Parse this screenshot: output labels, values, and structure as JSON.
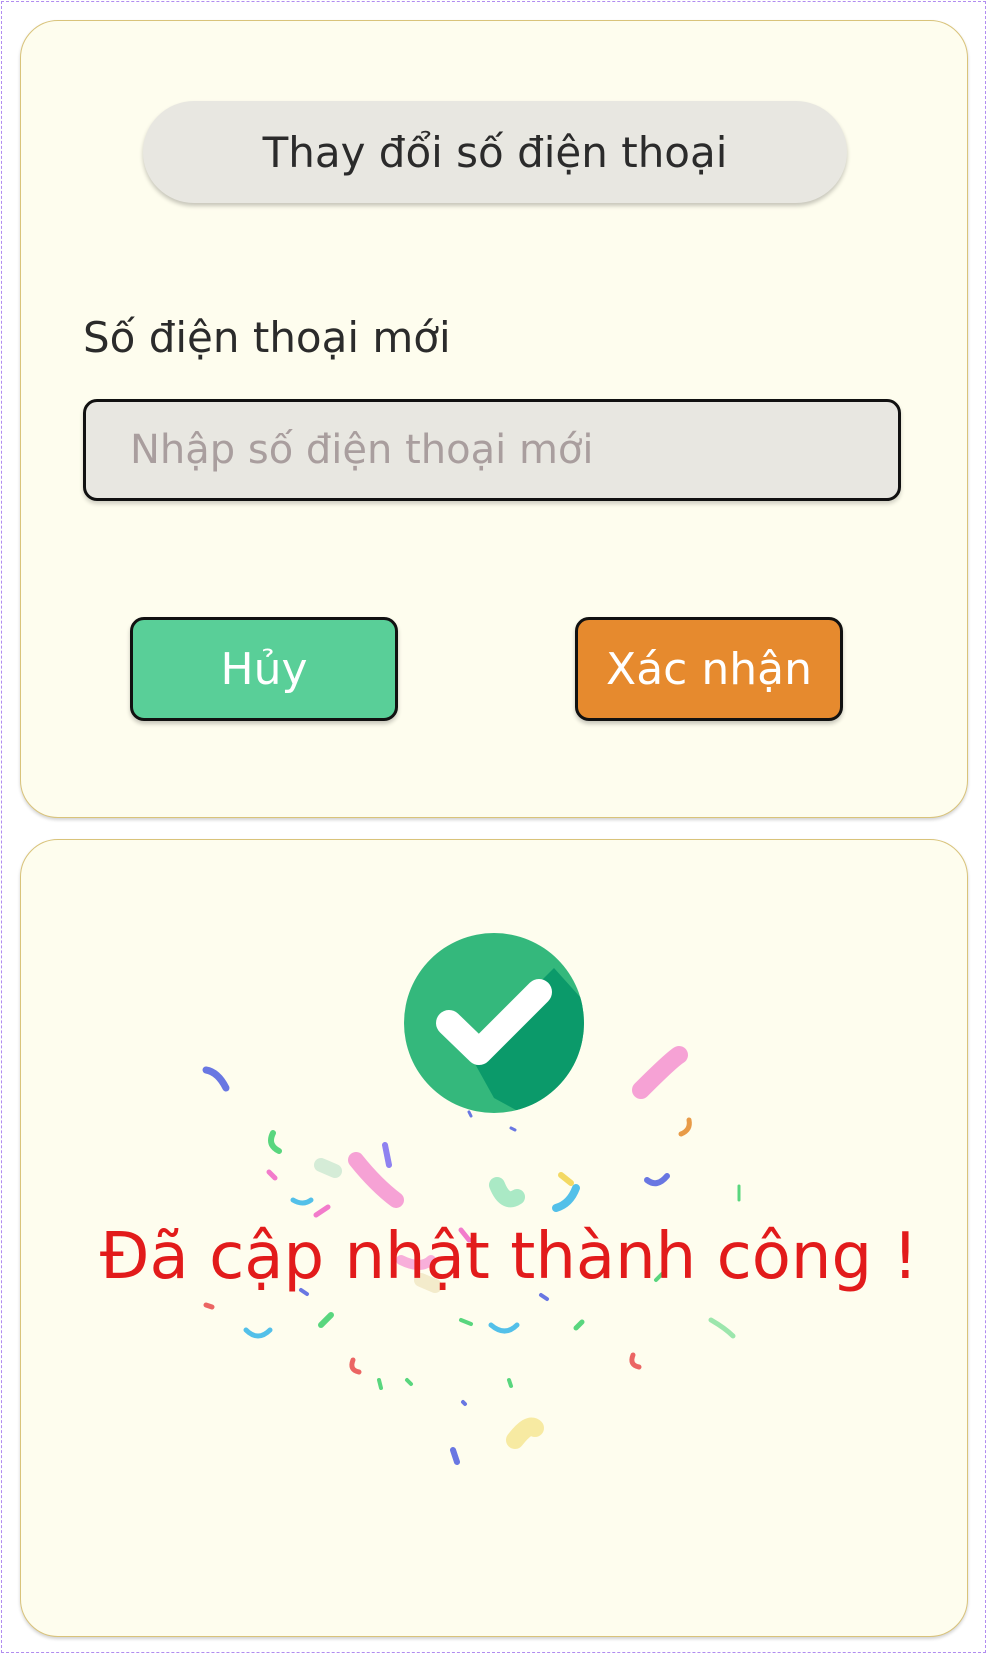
{
  "dialog": {
    "title": "Thay đổi số điện thoại",
    "field_label": "Số điện thoại mới",
    "input_placeholder": "Nhập số điện thoại mới",
    "input_value": "",
    "cancel_label": "Hủy",
    "confirm_label": "Xác nhận"
  },
  "success": {
    "message": "Đã cập nhật thành công !",
    "icon": "check-circle-icon"
  },
  "colors": {
    "card_bg": "#fefdee",
    "cancel": "#59cf98",
    "confirm": "#e68a2e",
    "check_green": "#34b87c",
    "message_red": "#e21b1b"
  }
}
